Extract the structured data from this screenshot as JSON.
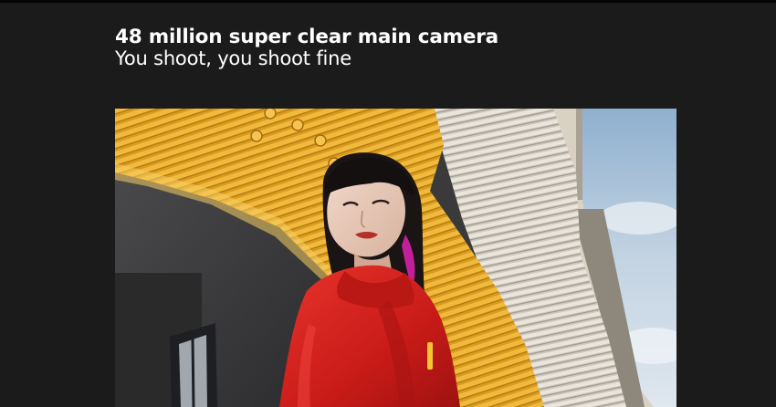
{
  "feature": {
    "title": "48 million super clear main camera",
    "subtitle": "You shoot, you shoot fine"
  },
  "photo": {
    "subject": "sample-photo"
  },
  "colors": {
    "background": "#1b1b1b",
    "text": "#ffffff",
    "pipes_yellow": "#e0a526",
    "jacket_red": "#d81f1c",
    "sky": "#b9cde0"
  }
}
